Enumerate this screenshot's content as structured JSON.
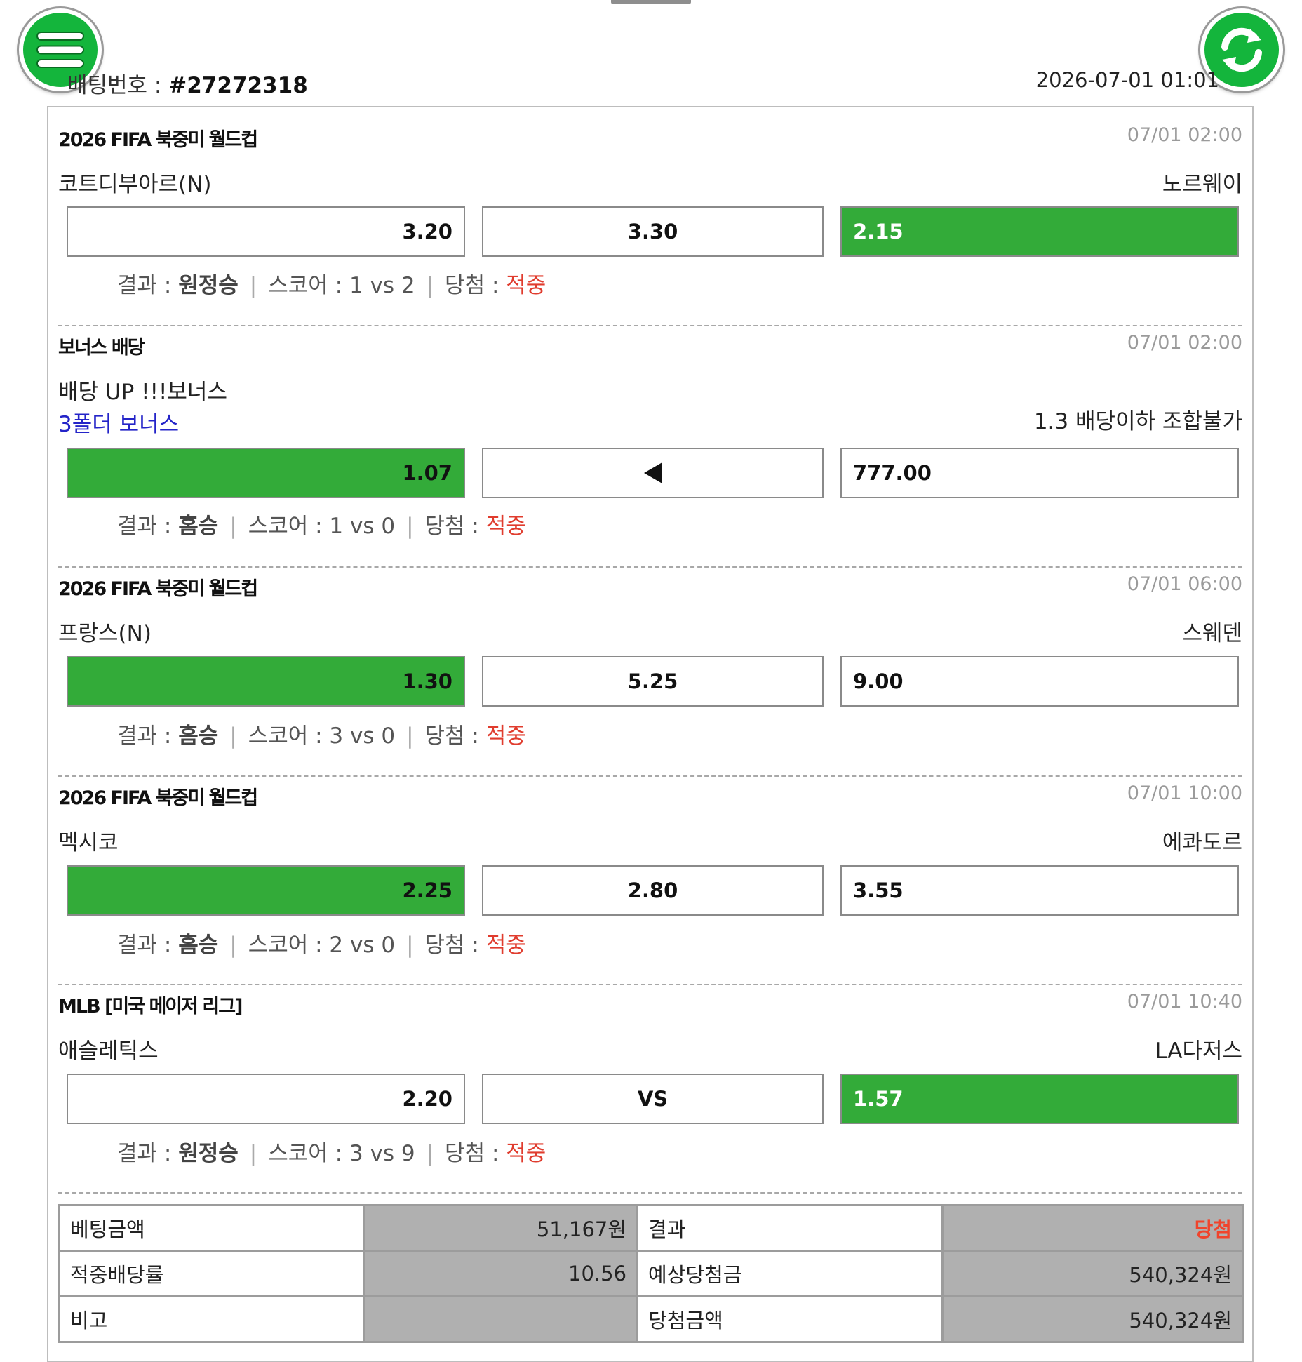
{
  "header": {
    "bet_label": "배팅번호 : ",
    "bet_number": "#27272318",
    "datetime": "2026-07-01 01:01"
  },
  "icons": {
    "menu": "hamburger-menu-icon",
    "refresh": "refresh-icon",
    "accent_color": "#14b53c"
  },
  "result_labels": {
    "result": "결과 : ",
    "score": "스코어 : ",
    "win": "당첨 : "
  },
  "games": [
    {
      "league": "2026 FIFA 북중미 월드컵",
      "time": "07/01 02:00",
      "home_team": "코트디부아르(N)",
      "away_team": "노르웨이",
      "odds": {
        "home": "3.20",
        "draw": "3.30",
        "away": "2.15"
      },
      "selected": "away",
      "result": "원정승",
      "score": "1 vs 2",
      "win_status": "적중"
    },
    {
      "league": "보너스 배당",
      "time": "07/01 02:00",
      "home_team": "배당 UP !!!보너스",
      "sub_left": "3폴더 보너스",
      "sub_right": "1.3 배당이하 조합불가",
      "odds": {
        "home": "1.07",
        "draw": "",
        "away": "777.00"
      },
      "draw_icon": "left-arrow-icon",
      "selected": "home",
      "result": "홈승",
      "score": "1 vs 0",
      "win_status": "적중"
    },
    {
      "league": "2026 FIFA 북중미 월드컵",
      "time": "07/01 06:00",
      "home_team": "프랑스(N)",
      "away_team": "스웨덴",
      "odds": {
        "home": "1.30",
        "draw": "5.25",
        "away": "9.00"
      },
      "selected": "home",
      "result": "홈승",
      "score": "3 vs 0",
      "win_status": "적중"
    },
    {
      "league": "2026 FIFA 북중미 월드컵",
      "time": "07/01 10:00",
      "home_team": "멕시코",
      "away_team": "에콰도르",
      "odds": {
        "home": "2.25",
        "draw": "2.80",
        "away": "3.55"
      },
      "selected": "home",
      "result": "홈승",
      "score": "2 vs 0",
      "win_status": "적중"
    },
    {
      "league": "MLB [미국 메이저 리그]",
      "time": "07/01 10:40",
      "home_team": "애슬레틱스",
      "away_team": "LA다저스",
      "odds": {
        "home": "2.20",
        "draw": "VS",
        "away": "1.57"
      },
      "selected": "away",
      "result": "원정승",
      "score": "3 vs 9",
      "win_status": "적중"
    }
  ],
  "summary": {
    "bet_amount_label": "베팅금액",
    "bet_amount": "51,167원",
    "result_label": "결과",
    "result": "당첨",
    "odds_label": "적중배당률",
    "odds": "10.56",
    "expected_label": "예상당첨금",
    "expected": "540,324원",
    "note_label": "비고",
    "note": "",
    "win_amount_label": "당첨금액",
    "win_amount": "540,324원"
  },
  "colors": {
    "selected_odds": "#33ab39",
    "win_text": "#e03c2e",
    "blue_text": "#2424c8",
    "gray_cell": "#b0b0b0"
  }
}
